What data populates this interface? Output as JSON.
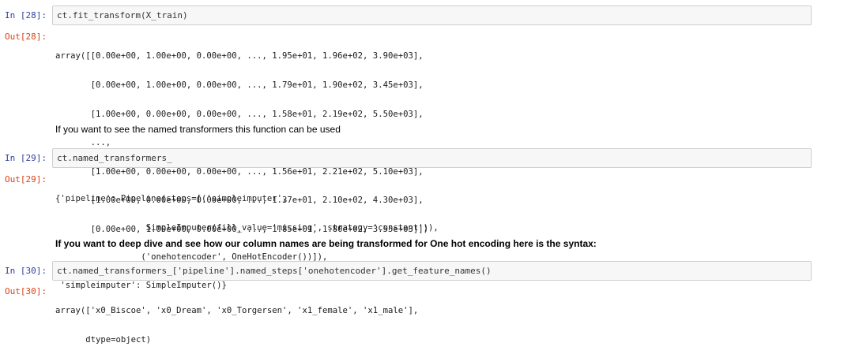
{
  "cells": [
    {
      "in_prompt": "In [28]:",
      "code": "ct.fit_transform(X_train)",
      "out_prompt": "Out[28]:",
      "output_lines": [
        "array([[0.00e+00, 1.00e+00, 0.00e+00, ..., 1.95e+01, 1.96e+02, 3.90e+03],",
        "       [0.00e+00, 1.00e+00, 0.00e+00, ..., 1.79e+01, 1.90e+02, 3.45e+03],",
        "       [1.00e+00, 0.00e+00, 0.00e+00, ..., 1.58e+01, 2.19e+02, 5.50e+03],",
        "       ...,",
        "       [1.00e+00, 0.00e+00, 0.00e+00, ..., 1.56e+01, 2.21e+02, 5.10e+03],",
        "       [1.00e+00, 0.00e+00, 0.00e+00, ..., 1.37e+01, 2.10e+02, 4.30e+03],",
        "       [0.00e+00, 1.00e+00, 0.00e+00, ..., 1.85e+01, 1.80e+02, 3.55e+03]])"
      ]
    },
    {
      "in_prompt": "In [29]:",
      "code": "ct.named_transformers_",
      "out_prompt": "Out[29]:",
      "output_lines": [
        "{'pipeline': Pipeline(steps=[('simpleimputer',",
        "                  SimpleImputer(fill_value='missing', strategy='constant')),",
        "                 ('onehotencoder', OneHotEncoder())]),",
        " 'simpleimputer': SimpleImputer()}"
      ]
    },
    {
      "in_prompt": "In [30]:",
      "code": "ct.named_transformers_['pipeline'].named_steps['onehotencoder'].get_feature_names()",
      "out_prompt": "Out[30]:",
      "output_lines": [
        "array(['x0_Biscoe', 'x0_Dream', 'x0_Torgersen', 'x1_female', 'x1_male'],",
        "      dtype=object)"
      ]
    }
  ],
  "markdown": {
    "named_transformers_note": "If you want to see the named transformers this function can be used",
    "deep_dive_note": "If you want to deep dive and see how our column names are being transformed for One hot encoding here is the syntax:"
  },
  "colors": {
    "in_prompt": "#303f9f",
    "out_prompt": "#d84315",
    "input_background": "#f7f7f7",
    "input_border": "#cfcfcf"
  }
}
